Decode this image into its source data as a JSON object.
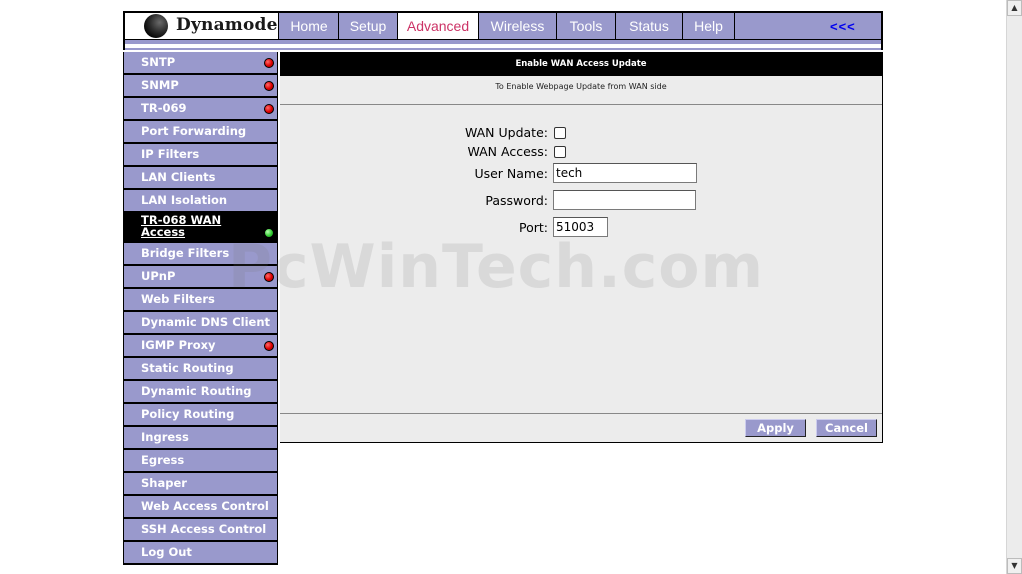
{
  "brand": {
    "name": "Dynamode"
  },
  "nav": {
    "items": [
      {
        "label": "Home"
      },
      {
        "label": "Setup"
      },
      {
        "label": "Advanced",
        "active": true
      },
      {
        "label": "Wireless"
      },
      {
        "label": "Tools"
      },
      {
        "label": "Status"
      },
      {
        "label": "Help"
      }
    ],
    "collapse": "<<<"
  },
  "sidebar": {
    "items": [
      {
        "label": "SNTP",
        "status": "red"
      },
      {
        "label": "SNMP",
        "status": "red"
      },
      {
        "label": "TR-069",
        "status": "red"
      },
      {
        "label": "Port Forwarding"
      },
      {
        "label": "IP Filters"
      },
      {
        "label": "LAN Clients"
      },
      {
        "label": "LAN Isolation"
      },
      {
        "label": "TR-068 WAN Access",
        "status": "green",
        "active": true
      },
      {
        "label": "Bridge Filters"
      },
      {
        "label": "UPnP",
        "status": "red"
      },
      {
        "label": "Web Filters"
      },
      {
        "label": "Dynamic DNS Client"
      },
      {
        "label": "IGMP Proxy",
        "status": "red"
      },
      {
        "label": "Static Routing"
      },
      {
        "label": "Dynamic Routing"
      },
      {
        "label": "Policy Routing"
      },
      {
        "label": "Ingress"
      },
      {
        "label": "Egress"
      },
      {
        "label": "Shaper"
      },
      {
        "label": "Web Access Control"
      },
      {
        "label": "SSH Access Control"
      },
      {
        "label": "Log Out"
      }
    ]
  },
  "main": {
    "title": "Enable WAN Access Update",
    "subtitle": "To Enable Webpage Update from WAN side",
    "form": {
      "wan_update_label": "WAN Update:",
      "wan_update_checked": false,
      "wan_access_label": "WAN Access:",
      "wan_access_checked": false,
      "username_label": "User Name:",
      "username_value": "tech",
      "password_label": "Password:",
      "password_value": "",
      "port_label": "Port:",
      "port_value": "51003"
    },
    "buttons": {
      "apply": "Apply",
      "cancel": "Cancel"
    }
  },
  "watermark": "PcWinTech.com",
  "colors": {
    "accent": "#9999cc",
    "active_tab_text": "#cc3366",
    "content_bg": "#ececec",
    "header_bg": "#000000",
    "status_red": "#dd0000",
    "status_green": "#33cc33"
  }
}
